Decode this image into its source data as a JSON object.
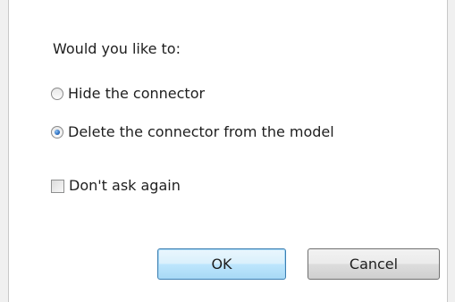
{
  "dialog": {
    "prompt": "Would you like to:",
    "options": [
      {
        "label": "Hide the connector",
        "selected": false
      },
      {
        "label": "Delete the connector from the model",
        "selected": true
      }
    ],
    "dont_ask_label": "Don't ask again",
    "dont_ask_checked": false,
    "ok_label": "OK",
    "cancel_label": "Cancel"
  }
}
